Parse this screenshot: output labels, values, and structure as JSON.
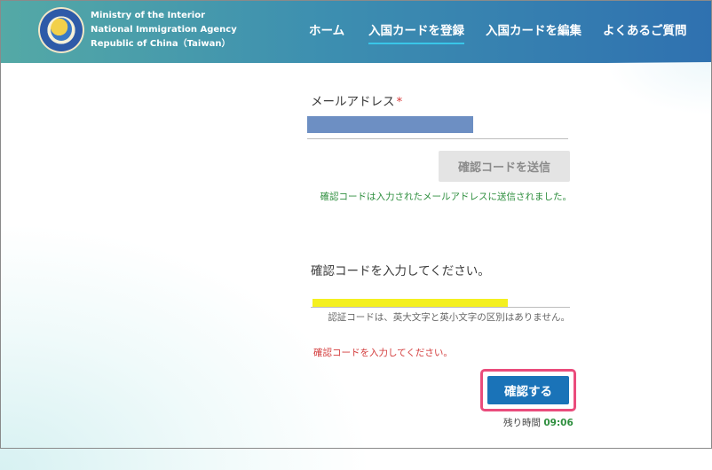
{
  "header": {
    "org_line1": "Ministry of the Interior",
    "org_line2": "National Immigration Agency",
    "org_line3": "Republic of China（Taiwan）",
    "nav": [
      {
        "label": "ホーム"
      },
      {
        "label": "入国カードを登録"
      },
      {
        "label": "入国カードを編集"
      },
      {
        "label": "よくあるご質問"
      }
    ],
    "active_nav": "入国カードを登録"
  },
  "form": {
    "email_label": "メールアドレス",
    "required_mark": "*",
    "send_code_button": "確認コードを送信",
    "send_code_note": "確認コードは入力されたメールアドレスに送信されました。",
    "code_label": "確認コードを入力してください。",
    "code_note": "認証コードは、英大文字と英小文字の区別はありません。",
    "code_error": "確認コードを入力してください。",
    "confirm_button": "確認する",
    "timer_label": "残り時間",
    "timer_value": "09:06"
  },
  "colors": {
    "header_start": "#54a9a6",
    "header_end": "#2f71b0",
    "active_underline": "#39c6e8",
    "confirm_button": "#1a73b8",
    "highlight_box": "#ea4c7c",
    "success_text": "#2f8f3f",
    "error_text": "#d33b3b"
  }
}
